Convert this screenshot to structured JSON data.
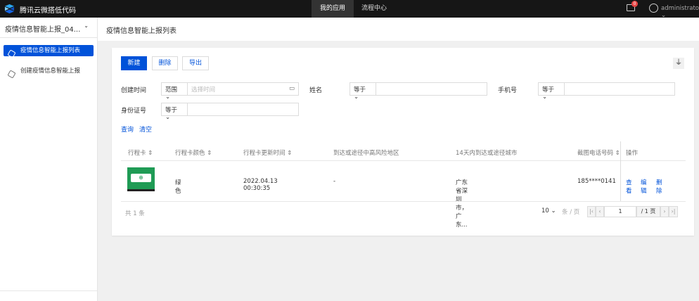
{
  "topbar": {
    "brand": "腾讯云微搭低代码",
    "nav": [
      "我的应用",
      "流程中心"
    ],
    "active_nav": "我的应用",
    "notifications": "0",
    "user": "administrator"
  },
  "sidebar": {
    "app": "疫情信息智能上报_04...",
    "items": [
      {
        "label": "疫情信息智能上报列表",
        "active": true
      },
      {
        "label": "创建疫情信息智能上报",
        "active": false
      }
    ]
  },
  "page": {
    "title": "疫情信息智能上报列表"
  },
  "toolbar": {
    "new": "新建",
    "delete": "删除",
    "export": "导出"
  },
  "filters": {
    "created_time": {
      "label": "创建时间",
      "op": "范围",
      "placeholder": "选择时间"
    },
    "name": {
      "label": "姓名",
      "op": "等于"
    },
    "phone": {
      "label": "手机号",
      "op": "等于"
    },
    "id_card": {
      "label": "身份证号",
      "op": "等于"
    },
    "query": "查询",
    "clear": "清空"
  },
  "table": {
    "columns": [
      "行程卡",
      "行程卡颜色",
      "行程卡更新时间",
      "到达或途径中高风险地区",
      "14天内到达或途径城市",
      "截图电话号码",
      "操作"
    ],
    "rows": [
      {
        "color": "绿色",
        "updated": "2022.04.13 00:30:35",
        "risk_area": "-",
        "cities": "广东省深圳市，广东...",
        "phone": "185****0141",
        "actions": [
          "查看",
          "编辑",
          "删除"
        ]
      }
    ]
  },
  "pagination": {
    "total": "共 1 条",
    "page_size": "10",
    "per_page": "条 / 页",
    "page": "1",
    "pages": "/ 1 页"
  },
  "colors": {
    "primary": "#0052d9",
    "topbar": "#161616",
    "card_green": "#1f9b55"
  }
}
